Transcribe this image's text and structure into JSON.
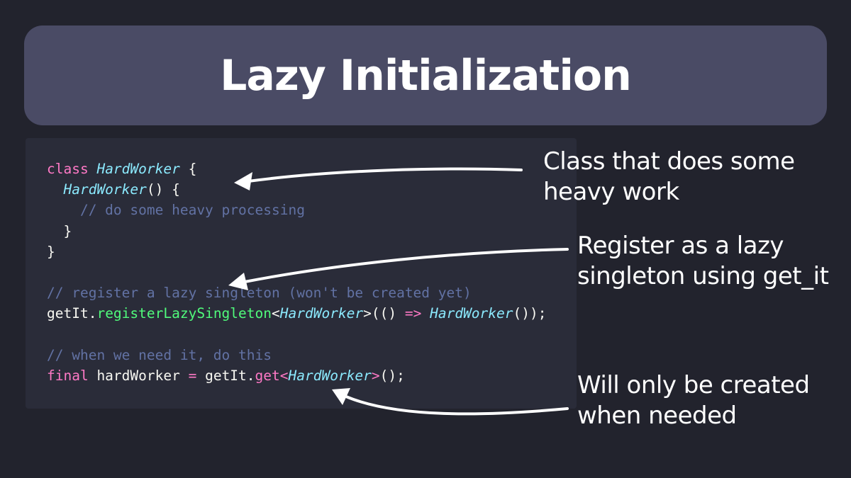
{
  "title": "Lazy Initialization",
  "colors": {
    "keyword": "#ff79c6",
    "class": "#8be9fd",
    "function": "#50fa7b",
    "comment": "#6272a4",
    "text": "#f8f8f2"
  },
  "code": [
    [
      [
        "kw",
        "class"
      ],
      [
        "tx",
        " "
      ],
      [
        "cls",
        "HardWorker"
      ],
      [
        "tx",
        " {"
      ]
    ],
    [
      [
        "tx",
        "  "
      ],
      [
        "cls",
        "HardWorker"
      ],
      [
        "tx",
        "() {"
      ]
    ],
    [
      [
        "cm",
        "    // do some heavy processing"
      ]
    ],
    [
      [
        "tx",
        "  }"
      ]
    ],
    [
      [
        "tx",
        "}"
      ]
    ],
    [],
    [
      [
        "cm",
        "// register a lazy singleton (won't be created yet)"
      ]
    ],
    [
      [
        "tx",
        "getIt."
      ],
      [
        "fn",
        "registerLazySingleton"
      ],
      [
        "tx",
        "<"
      ],
      [
        "cls",
        "HardWorker"
      ],
      [
        "tx",
        ">(() "
      ],
      [
        "kw",
        "=>"
      ],
      [
        "tx",
        " "
      ],
      [
        "cls",
        "HardWorker"
      ],
      [
        "tx",
        "());"
      ]
    ],
    [],
    [
      [
        "cm",
        "// when we need it, do this"
      ]
    ],
    [
      [
        "kw",
        "final"
      ],
      [
        "tx",
        " hardWorker "
      ],
      [
        "kw",
        "="
      ],
      [
        "tx",
        " getIt."
      ],
      [
        "kw",
        "get<"
      ],
      [
        "cls",
        "HardWorker"
      ],
      [
        "kw",
        ">"
      ],
      [
        "tx",
        "();"
      ]
    ]
  ],
  "notes": {
    "class_note": [
      "Class that does some",
      "heavy work"
    ],
    "register_note": [
      "Register as a lazy",
      "singleton using get_it"
    ],
    "get_note": [
      "Will only be created",
      "when needed"
    ]
  }
}
